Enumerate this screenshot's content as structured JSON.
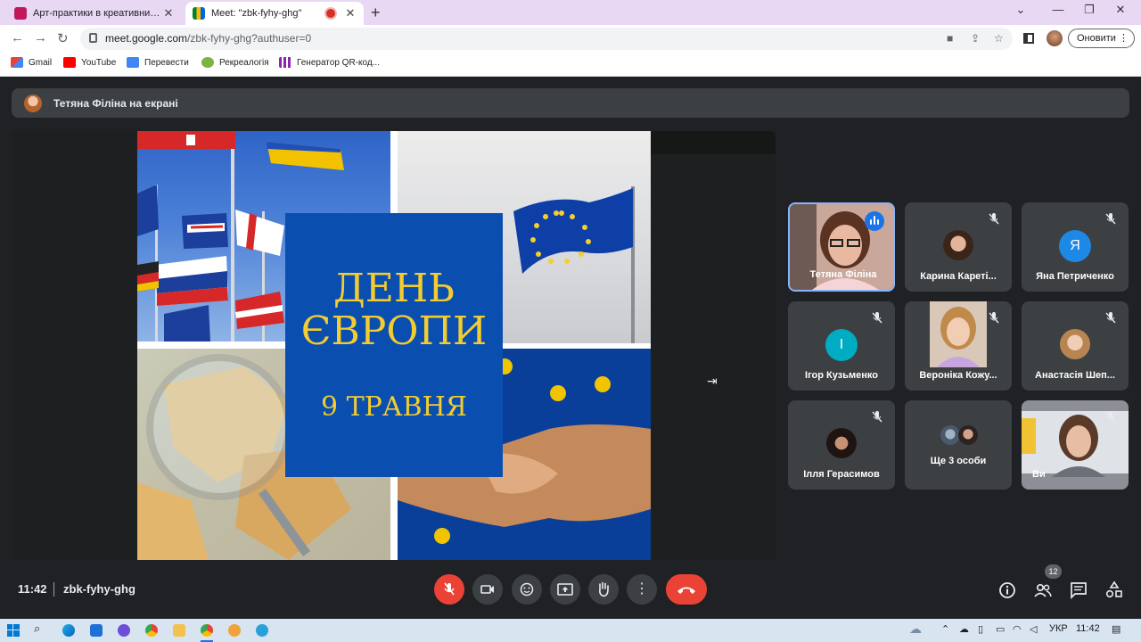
{
  "browser": {
    "tabs": [
      {
        "title": "Арт-практики в креативних інд"
      },
      {
        "title": "Meet: \"zbk-fyhy-ghg\""
      }
    ],
    "url_host": "meet.google.com",
    "url_path": "/zbk-fyhy-ghg?authuser=0",
    "update_label": "Оновити",
    "bookmarks": [
      "Gmail",
      "YouTube",
      "Перевести",
      "Рекреалогія",
      "Генератор QR-код..."
    ]
  },
  "meet": {
    "presenting_text": "Тетяна Філіна на екрані",
    "slide": {
      "line1": "ДЕНЬ",
      "line2": "ЄВРОПИ",
      "date": "9 ТРАВНЯ"
    },
    "participants": [
      {
        "name": "Тетяна Філіна",
        "speaking": true
      },
      {
        "name": "Карина Кареті...",
        "muted": true
      },
      {
        "name": "Яна Петриченко",
        "muted": true,
        "initial": "Я",
        "color": "#1e88e5"
      },
      {
        "name": "Ігор Кузьменко",
        "muted": true,
        "initial": "І",
        "color": "#00acc1"
      },
      {
        "name": "Вероніка Кожу...",
        "muted": true
      },
      {
        "name": "Анастасія Шеп...",
        "muted": true
      },
      {
        "name": "Ілля Герасимов",
        "muted": true
      },
      {
        "name": "Ще 3 особи"
      },
      {
        "name": "Ви",
        "muted": true
      }
    ],
    "time": "11:42",
    "meeting_code": "zbk-fyhy-ghg",
    "people_count": "12",
    "colors": {
      "accent_blue": "#1a73e8",
      "danger_red": "#ea4335",
      "tile_bg": "#3c4043"
    }
  },
  "taskbar": {
    "language": "УКР",
    "clock": "11:42"
  }
}
